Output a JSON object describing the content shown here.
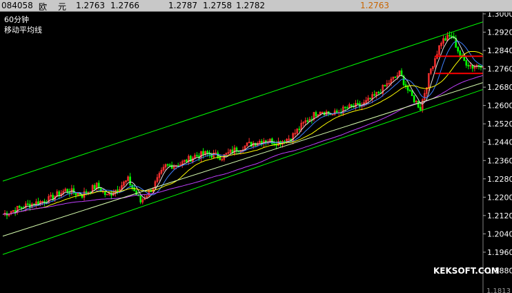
{
  "header": {
    "code": "084058",
    "name_part1": "欧",
    "name_part2": "元",
    "open": "1.2763",
    "high_quote": "1.2766",
    "high": "1.2787",
    "low": "1.2758",
    "close": "1.2782",
    "last": "1.2763"
  },
  "labels": {
    "period": "60分钟",
    "indicator": "移动平均线",
    "watermark": "KEKSOFT.COM",
    "axis_bottom": "1.1813"
  },
  "colors": {
    "background": "#000000",
    "up_candle": "#ff3030",
    "down_candle": "#00ff00",
    "channel": "#00ff00",
    "ma_short": "#e0e0e0",
    "ma_mid": "#ffff00",
    "ma_long": "#c040ff",
    "ma_blue": "#4080ff",
    "resistance": "#ff0000"
  },
  "chart_data": {
    "type": "candlestick",
    "ylim": [
      1.18,
      1.3
    ],
    "yticks": [
      "1.3000",
      "1.2920",
      "1.2840",
      "1.2760",
      "1.2680",
      "1.2600",
      "1.2520",
      "1.2440",
      "1.2360",
      "1.2280",
      "1.2200",
      "1.2120",
      "1.2040",
      "1.1960",
      "1.1880"
    ],
    "ytick_values": [
      1.3,
      1.292,
      1.284,
      1.276,
      1.268,
      1.26,
      1.252,
      1.244,
      1.236,
      1.228,
      1.22,
      1.212,
      1.204,
      1.196,
      1.188
    ],
    "bars": 230,
    "price_path": [
      [
        0,
        1.2125
      ],
      [
        10,
        1.216
      ],
      [
        22,
        1.219
      ],
      [
        30,
        1.223
      ],
      [
        38,
        1.221
      ],
      [
        45,
        1.225
      ],
      [
        50,
        1.2205
      ],
      [
        55,
        1.224
      ],
      [
        60,
        1.2275
      ],
      [
        66,
        1.218
      ],
      [
        72,
        1.2245
      ],
      [
        78,
        1.2335
      ],
      [
        85,
        1.2345
      ],
      [
        92,
        1.238
      ],
      [
        98,
        1.239
      ],
      [
        105,
        1.2375
      ],
      [
        112,
        1.241
      ],
      [
        118,
        1.243
      ],
      [
        125,
        1.245
      ],
      [
        132,
        1.244
      ],
      [
        138,
        1.246
      ],
      [
        145,
        1.253
      ],
      [
        152,
        1.258
      ],
      [
        158,
        1.256
      ],
      [
        165,
        1.259
      ],
      [
        172,
        1.26
      ],
      [
        178,
        1.264
      ],
      [
        185,
        1.27
      ],
      [
        190,
        1.274
      ],
      [
        195,
        1.265
      ],
      [
        200,
        1.259
      ],
      [
        205,
        1.276
      ],
      [
        210,
        1.288
      ],
      [
        215,
        1.2905
      ],
      [
        220,
        1.28
      ],
      [
        225,
        1.277
      ],
      [
        230,
        1.2782
      ]
    ],
    "channel_upper": [
      [
        0,
        1.227
      ],
      [
        230,
        1.2965
      ]
    ],
    "channel_lower": [
      [
        0,
        1.195
      ],
      [
        230,
        1.267
      ]
    ],
    "support_line": [
      [
        0,
        1.203
      ],
      [
        230,
        1.27
      ]
    ],
    "resistance_levels": [
      1.2815,
      1.274
    ]
  }
}
